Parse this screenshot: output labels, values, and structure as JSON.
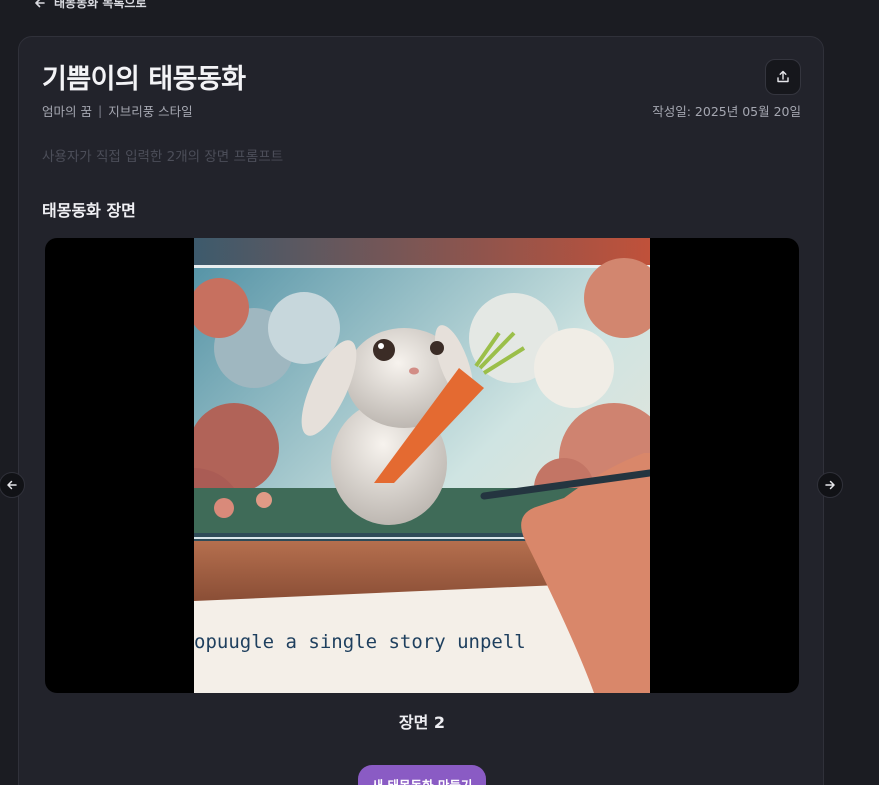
{
  "back_link": {
    "label": "태몽동화 목록으로",
    "icon": "arrow-left-icon"
  },
  "story": {
    "title": "기쁨이의 태몽동화",
    "dreamer": "엄마의 꿈",
    "separator": "|",
    "style": "지브리풍 스타일",
    "date_label": "작성일: 2025년 05월 20일",
    "prompt_note": "사용자가 직접 입력한 2개의 장면 프롬프트"
  },
  "share": {
    "icon": "share-icon"
  },
  "scenes_section": {
    "title": "태몽동화 장면"
  },
  "scene": {
    "caption": "장면 2",
    "image_text": "opuugle  a single  story unpell"
  },
  "nav": {
    "prev_icon": "arrow-left-icon",
    "next_icon": "arrow-right-icon"
  },
  "actions": {
    "new_story_label": "새 태몽동화 만들기"
  },
  "colors": {
    "background": "#1b1c22",
    "card": "#22232b",
    "accent": "#8a5bc4"
  }
}
